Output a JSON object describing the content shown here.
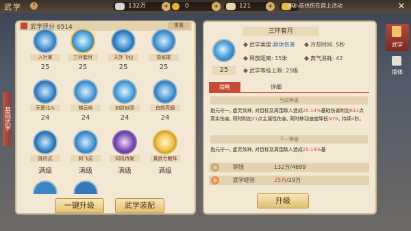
{
  "header": {
    "title": "武学",
    "help": "?",
    "event_text": "多小孩也伤在首上活动"
  },
  "resources": [
    {
      "name": "silver-ingot",
      "value": "132万"
    },
    {
      "name": "gold-coin",
      "value": "0"
    },
    {
      "name": "scroll",
      "value": "121"
    },
    {
      "name": "gold-ingot",
      "value": "0"
    }
  ],
  "side_tab": {
    "label": "基础武学"
  },
  "left": {
    "score_label": "武学评分 6514",
    "reset_label": "重置",
    "skills": [
      {
        "name": "入针掌",
        "level": "25"
      },
      {
        "name": "三环套月",
        "level": "25"
      },
      {
        "name": "天外飞仙",
        "level": "25"
      },
      {
        "name": "揽雀尾",
        "level": "25"
      },
      {
        "name": "天罡北斗",
        "level": "24"
      },
      {
        "name": "梯云纵",
        "level": "24"
      },
      {
        "name": "如封似闭",
        "level": "24"
      },
      {
        "name": "白鹤亮翅",
        "level": "24"
      },
      {
        "name": "挑帘式",
        "level": "满级"
      },
      {
        "name": "斜飞式",
        "level": "满级"
      },
      {
        "name": "伺机待发",
        "level": "满级"
      },
      {
        "name": "真武七截阵",
        "level": "满级"
      }
    ],
    "btn_upgrade_all": "一键升级",
    "btn_equip": "武学装配"
  },
  "detail": {
    "title": "三环套月",
    "level": "25",
    "attrs": {
      "type_label": "武学类型:",
      "type_value": "群体伤害",
      "cooldown_label": "冷却时间:",
      "cooldown_value": "5秒",
      "range_label": "释放距离:",
      "range_value": "15米",
      "qi_label": "真气消耗:",
      "qi_value": "42",
      "cap_label": "武学等级上限:",
      "cap_value": "25级"
    },
    "tabs": [
      "简略",
      "详细"
    ],
    "current_head": "当前等级",
    "current_desc": [
      "抱元守一, 虚灵敛神, 对目标及周围敌人造成",
      "25.14%",
      "基础伤害附加",
      "611",
      "点真实伤害, 同时附加",
      "21",
      "点主属性伤害, 同时移动速度降低",
      "30%",
      ", 持续",
      "4",
      "秒。"
    ],
    "next_head": "下一等级",
    "next_desc": [
      "抱元守一, 虚灵敛神, 对目标及周围敌人造成",
      "25.14%",
      "基"
    ],
    "cost_coin_label": "铜钱",
    "cost_coin_have": "132万",
    "cost_coin_need": "/4699",
    "cost_exp_label": "武学经验",
    "cost_exp_have": "25万",
    "cost_exp_need": "/29万",
    "btn_upgrade": "升级"
  },
  "right_tabs": [
    "武学",
    "锻体"
  ],
  "colors": {
    "accent_red": "#c84b36",
    "panel": "#f2e8d4",
    "gold": "#e1bf75"
  }
}
